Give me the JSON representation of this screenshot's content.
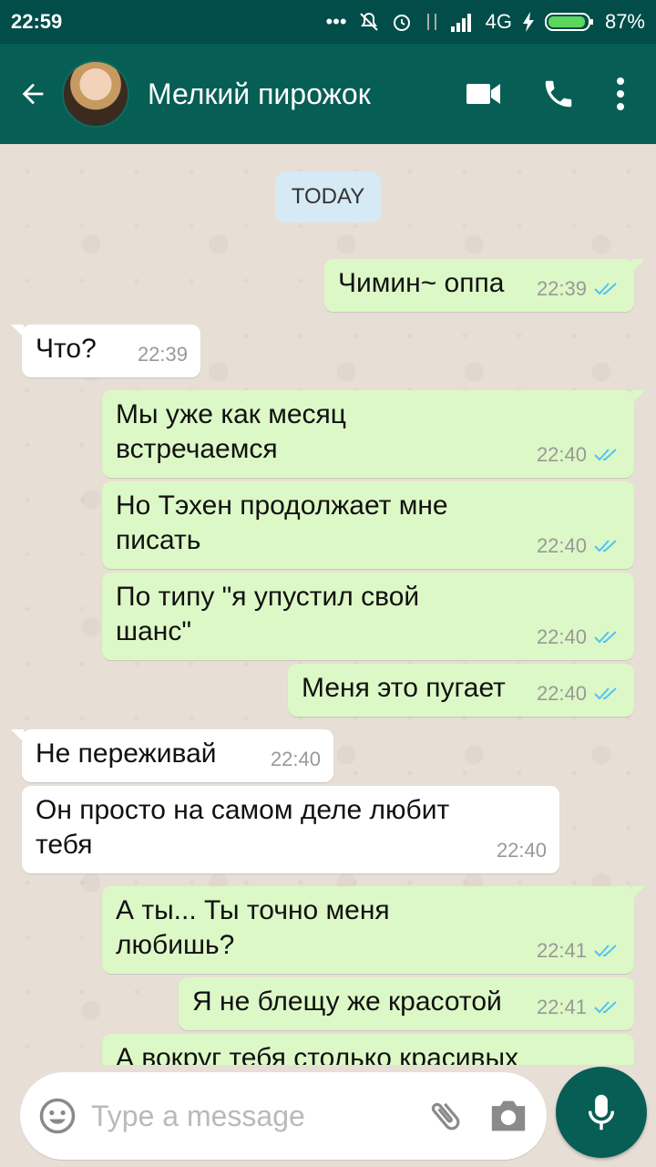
{
  "status": {
    "time": "22:59",
    "network": "4G",
    "battery": "87%"
  },
  "header": {
    "contact_name": "Мелкий пирожок"
  },
  "chat": {
    "date_label": "TODAY",
    "messages": [
      {
        "dir": "out",
        "text": "Чимин~ оппа",
        "time": "22:39"
      },
      {
        "dir": "in",
        "text": "Что?",
        "time": "22:39"
      },
      {
        "dir": "out",
        "text": "Мы уже как месяц\nвстречаемся",
        "time": "22:40"
      },
      {
        "dir": "out",
        "text": "Но Тэхен продолжает мне\nписать",
        "time": "22:40"
      },
      {
        "dir": "out",
        "text": "По типу \"я упустил свой\nшанс\"",
        "time": "22:40"
      },
      {
        "dir": "out",
        "text": "Меня это пугает",
        "time": "22:40"
      },
      {
        "dir": "in",
        "text": "Не переживай",
        "time": "22:40"
      },
      {
        "dir": "in",
        "text": "Он просто на самом деле любит\nтебя",
        "time": "22:40"
      },
      {
        "dir": "out",
        "text": "А ты... Ты точно меня\nлюбишь?",
        "time": "22:41"
      },
      {
        "dir": "out",
        "text": "Я не блещу же красотой",
        "time": "22:41"
      },
      {
        "dir": "out",
        "text": "А вокруг тебя столько красивых",
        "time": ""
      }
    ]
  },
  "composer": {
    "placeholder": "Type a message"
  },
  "colors": {
    "header": "#075e54",
    "statusbar": "#024d49",
    "outgoing": "#dcf8c6",
    "incoming": "#ffffff",
    "tick": "#4fc3f7"
  },
  "icons": [
    "back-arrow-icon",
    "video-call-icon",
    "phone-icon",
    "more-icon",
    "emoji-icon",
    "attach-icon",
    "camera-icon",
    "mic-icon",
    "read-ticks-icon"
  ]
}
